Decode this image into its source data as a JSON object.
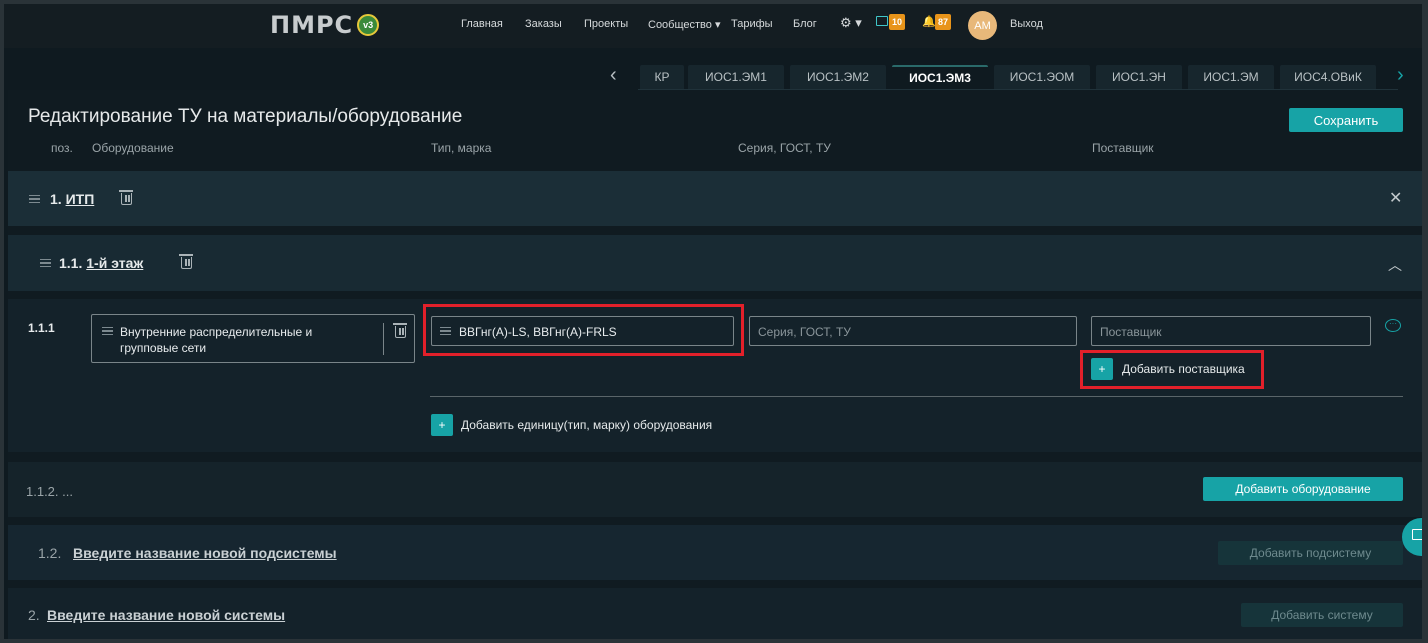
{
  "nav": {
    "logo_text": "ПМРС",
    "logo_badge": "v3",
    "links": [
      "Главная",
      "Заказы",
      "Проекты",
      "Сообщество ▾",
      "Тарифы",
      "Блог"
    ],
    "settings_label": "⚙ ▾",
    "messages_count": "10",
    "notifications_count": "87",
    "avatar_initials": "АМ",
    "logout": "Выход"
  },
  "tabs": {
    "items": [
      "КР",
      "ИОС1.ЭМ1",
      "ИОС1.ЭМ2",
      "ИОС1.ЭМ3",
      "ИОС1.ЭОМ",
      "ИОС1.ЭН",
      "ИОС1.ЭМ",
      "ИОС4.ОВиК"
    ],
    "active": "ИОС1.ЭМ3"
  },
  "header": {
    "title": "Редактирование ТУ на материалы/оборудование",
    "save": "Сохранить",
    "columns": {
      "pos": "поз.",
      "equipment": "Оборудование",
      "type": "Тип, марка",
      "series": "Серия, ГОСТ, ТУ",
      "supplier": "Поставщик"
    }
  },
  "system1": {
    "number": "1.",
    "name": "ИТП"
  },
  "subsystem11": {
    "number": "1.1.",
    "name": "1-й этаж"
  },
  "equipment": {
    "pos": "1.1.1",
    "name": "Внутренние распределительные и групповые сети",
    "type_value": "ВВГнг(A)-LS, ВВГнг(A)-FRLS",
    "series_placeholder": "Серия, ГОСТ, ТУ",
    "supplier_placeholder": "Поставщик",
    "add_supplier": "Добавить поставщика",
    "add_unit": "Добавить единицу(тип, марку) оборудования"
  },
  "row112": {
    "label": "1.1.2. ...",
    "add_equipment": "Добавить оборудование"
  },
  "subsystem12": {
    "number": "1.2.",
    "name": "Введите название новой подсистемы",
    "add": "Добавить подсистему"
  },
  "system2": {
    "number": "2.",
    "name": "Введите название новой системы",
    "add": "Добавить систему"
  },
  "colors": {
    "accent": "#17a3a6",
    "highlight": "#e3202a",
    "badge": "#e8941a"
  }
}
